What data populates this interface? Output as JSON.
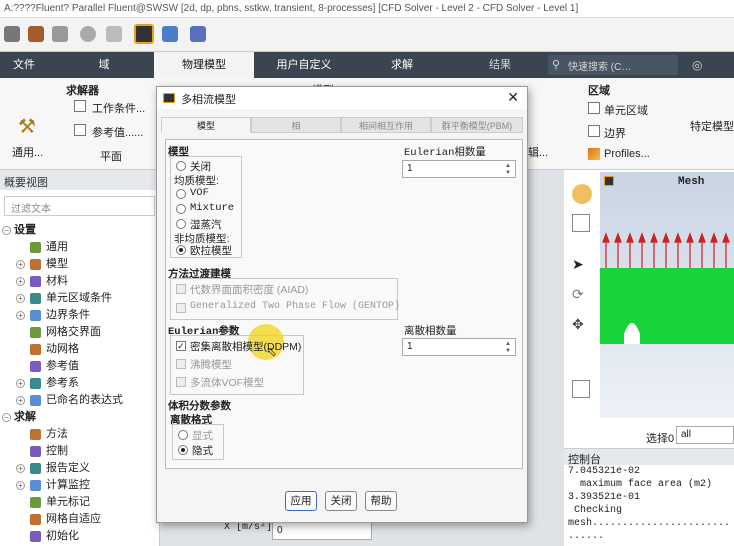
{
  "window_title": "A:????Fluent? Parallel Fluent@SWSW  [2d, dp, pbns, sstkw, transient, 8-processes] [CFD Solver - Level 2 - CFD Solver - Level 1]",
  "ribbon_tabs": [
    "文件",
    "域",
    "物理模型",
    "用户自定义",
    "求解"
  ],
  "ribbon_tab_extra": "结果",
  "search_placeholder": "快速搜索 (C…",
  "ribbon": {
    "solver_group": "求解器",
    "working_conditions": "工作条件...",
    "reference_values": "参考值......",
    "general_label": "通用...",
    "plane_label": "平面",
    "models_partial": "模型",
    "materials_partial": "辑...",
    "region_group": "区域",
    "cell_zone": "单元区域",
    "boundary": "边界",
    "profiles": "Profiles...",
    "specific_model": "特定模型"
  },
  "tree": {
    "header": "概要视图",
    "filter_placeholder": "过滤文本",
    "items": [
      {
        "label": "设置",
        "section": true
      },
      {
        "label": "通用"
      },
      {
        "label": "模型",
        "exp": true
      },
      {
        "label": "材料",
        "exp": true
      },
      {
        "label": "单元区域条件",
        "exp": true
      },
      {
        "label": "边界条件",
        "exp": true
      },
      {
        "label": "网格交界面"
      },
      {
        "label": "动网格"
      },
      {
        "label": "参考值"
      },
      {
        "label": "参考系",
        "exp": true
      },
      {
        "label": "已命名的表达式",
        "exp": true
      },
      {
        "label": "求解",
        "section": true
      },
      {
        "label": "方法"
      },
      {
        "label": "控制"
      },
      {
        "label": "报告定义",
        "exp": true
      },
      {
        "label": "计算监控",
        "exp": true
      },
      {
        "label": "单元标记"
      },
      {
        "label": "网格自适应"
      },
      {
        "label": "初始化"
      }
    ]
  },
  "dialog": {
    "title": "多相流模型",
    "tabs": [
      "模型",
      "相",
      "相间相互作用",
      "群平衡模型(PBM)"
    ],
    "models_title": "模型",
    "model_off": "关闭",
    "homogeneous_label": "均质模型:",
    "vof": "VOF",
    "mixture": "Mixture",
    "wet_steam": "湿蒸汽",
    "nonhomogeneous_label": "非均质模型:",
    "eulerian": "欧拉模型",
    "eulerian_phase_count_label": "Eulerian相数量",
    "eulerian_phase_count": "1",
    "transition_title": "方法过渡建模",
    "aiad": "代数界面面积密度 (AIAD)",
    "gentop": "Generalized Two Phase Flow (GENTOP)",
    "eulerian_params_title": "Eulerian参数",
    "ddpm": "密集离散相模型(DDPM)",
    "boiling": "沸腾模型",
    "multifluid_vof": "多流体VOF模型",
    "discrete_phase_count_label": "离散相数量",
    "discrete_phase_count": "1",
    "volume_fraction_title": "体积分数参数",
    "discretization_title": "离散格式",
    "explicit": "显式",
    "implicit": "隐式",
    "apply_button": "应用",
    "close_button": "关闭",
    "help_button": "帮助"
  },
  "graphics": {
    "title": "Mesh",
    "select_label": "选择0",
    "select_value": "all"
  },
  "console": {
    "title": "控制台",
    "lines": [
      "7.045321e-02",
      "  maximum face area (m2)",
      "3.393521e-01",
      " Checking",
      "mesh.......................",
      "......"
    ]
  },
  "bottom_field": {
    "label": "X [m/s²]",
    "value": "0"
  },
  "colors": {
    "ribbon_tab_bg": "#3a4550",
    "mesh_fill": "#19d33a",
    "arrow": "#cc2020"
  }
}
